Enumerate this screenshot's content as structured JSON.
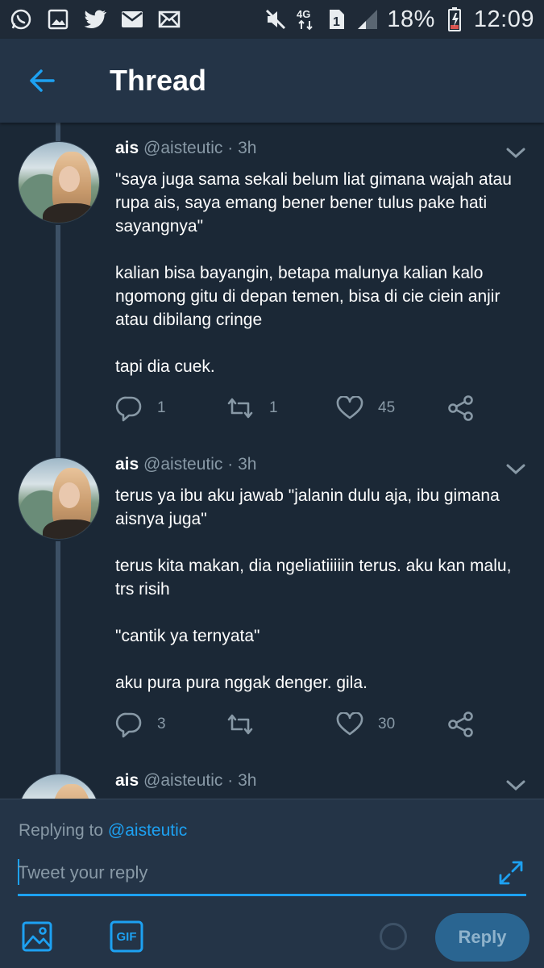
{
  "status_bar": {
    "left_icons": [
      "whatsapp-icon",
      "gallery-icon",
      "twitter-icon",
      "email-icon",
      "mail-icon"
    ],
    "right_icons": [
      "mute-icon",
      "4g-icon",
      "sim-1-icon",
      "signal-icon"
    ],
    "battery_percent": "18%",
    "time": "12:09"
  },
  "app_bar": {
    "title": "Thread",
    "back_icon": "arrow-left-icon"
  },
  "tweets": [
    {
      "name": "ais",
      "handle": "@aisteutic · 3h",
      "paragraphs": [
        "\"saya juga sama sekali belum liat gimana wajah atau rupa ais, saya emang bener bener tulus pake hati sayangnya\"",
        "kalian bisa bayangin, betapa malunya kalian kalo ngomong gitu di depan temen, bisa di cie ciein anjir atau dibilang cringe",
        "tapi dia cuek."
      ],
      "replies": "1",
      "retweets": "1",
      "likes": "45"
    },
    {
      "name": "ais",
      "handle": "@aisteutic · 3h",
      "paragraphs": [
        "terus ya ibu aku jawab \"jalanin dulu aja, ibu gimana aisnya juga\"",
        "terus kita makan, dia ngeliatiiiiin terus. aku kan malu, trs risih",
        "\"cantik ya ternyata\"",
        "aku pura pura nggak denger. gila."
      ],
      "replies": "3",
      "retweets": "",
      "likes": "30"
    },
    {
      "name": "ais",
      "handle": "@aisteutic · 3h"
    }
  ],
  "composer": {
    "replying_prefix": "Replying to",
    "replying_handle": "@aisteutic",
    "placeholder": "Tweet your reply",
    "gif_label": "GIF",
    "reply_label": "Reply"
  },
  "colors": {
    "background": "#1b2836",
    "app_bar": "#243447",
    "accent": "#1da1f2",
    "muted_text": "#8899a6",
    "thread_line": "#3d5166",
    "reply_button": "#2a6591"
  }
}
